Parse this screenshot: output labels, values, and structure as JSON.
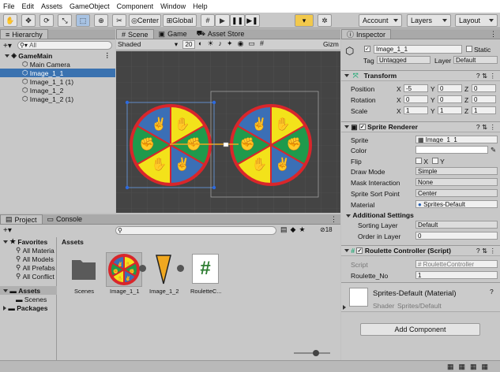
{
  "menu": [
    "File",
    "Edit",
    "Assets",
    "GameObject",
    "Component",
    "Window",
    "Help"
  ],
  "toolbar": {
    "center": "Center",
    "global": "Global",
    "account": "Account",
    "layers": "Layers",
    "layout": "Layout"
  },
  "hierarchy": {
    "tab": "Hierarchy",
    "search_placeholder": "All",
    "scene": "GameMain",
    "items": [
      "Main Camera",
      "Image_1_1",
      "Image_1_1 (1)",
      "Image_1_2",
      "Image_1_2 (1)"
    ]
  },
  "scene": {
    "tabs": [
      "Scene",
      "Game",
      "Asset Store"
    ],
    "shading": "Shaded",
    "gizmos_value": "20",
    "gizmos": "Gizm"
  },
  "project": {
    "tabs": [
      "Project",
      "Console"
    ],
    "favorites": "Favorites",
    "fav_items": [
      "All Materia",
      "All Models",
      "All Prefabs",
      "All Conflict"
    ],
    "assets": "Assets",
    "asset_children": [
      "Scenes"
    ],
    "packages": "Packages",
    "breadcrumb": "Assets",
    "count": "18",
    "files": [
      "Scenes",
      "Image_1_1",
      "Image_1_2",
      "RouletteC..."
    ]
  },
  "inspector": {
    "tab": "Inspector",
    "name": "Image_1_1",
    "static": "Static",
    "tag_label": "Tag",
    "tag": "Untagged",
    "layer_label": "Layer",
    "layer": "Default",
    "transform": {
      "title": "Transform",
      "rows": [
        {
          "label": "Position",
          "x": "-5",
          "y": "0",
          "z": "0"
        },
        {
          "label": "Rotation",
          "x": "0",
          "y": "0",
          "z": "0"
        },
        {
          "label": "Scale",
          "x": "1",
          "y": "1",
          "z": "1"
        }
      ]
    },
    "sprite_renderer": {
      "title": "Sprite Renderer",
      "sprite_label": "Sprite",
      "sprite": "Image_1_1",
      "color_label": "Color",
      "flip_label": "Flip",
      "flip_x": "X",
      "flip_y": "Y",
      "draw_mode_label": "Draw Mode",
      "draw_mode": "Simple",
      "mask_label": "Mask Interaction",
      "mask": "None",
      "sort_point_label": "Sprite Sort Point",
      "sort_point": "Center",
      "material_label": "Material",
      "material": "Sprites-Default",
      "additional": "Additional Settings",
      "sorting_layer_label": "Sorting Layer",
      "sorting_layer": "Default",
      "order_label": "Order in Layer",
      "order": "0"
    },
    "roulette": {
      "title": "Roulette Controller (Script)",
      "script_label": "Script",
      "script": "RouletteController",
      "no_label": "Roulette_No",
      "no": "1"
    },
    "material": {
      "title": "Sprites-Default (Material)",
      "shader_label": "Shader",
      "shader": "Sprites/Default"
    },
    "add_component": "Add Component"
  },
  "colors": {
    "selection": "#3a72b0",
    "wheel_red": "#d9262b",
    "wheel_yellow": "#f3e21a",
    "wheel_green": "#1f9a4c",
    "wheel_blue": "#3b6fb6"
  }
}
